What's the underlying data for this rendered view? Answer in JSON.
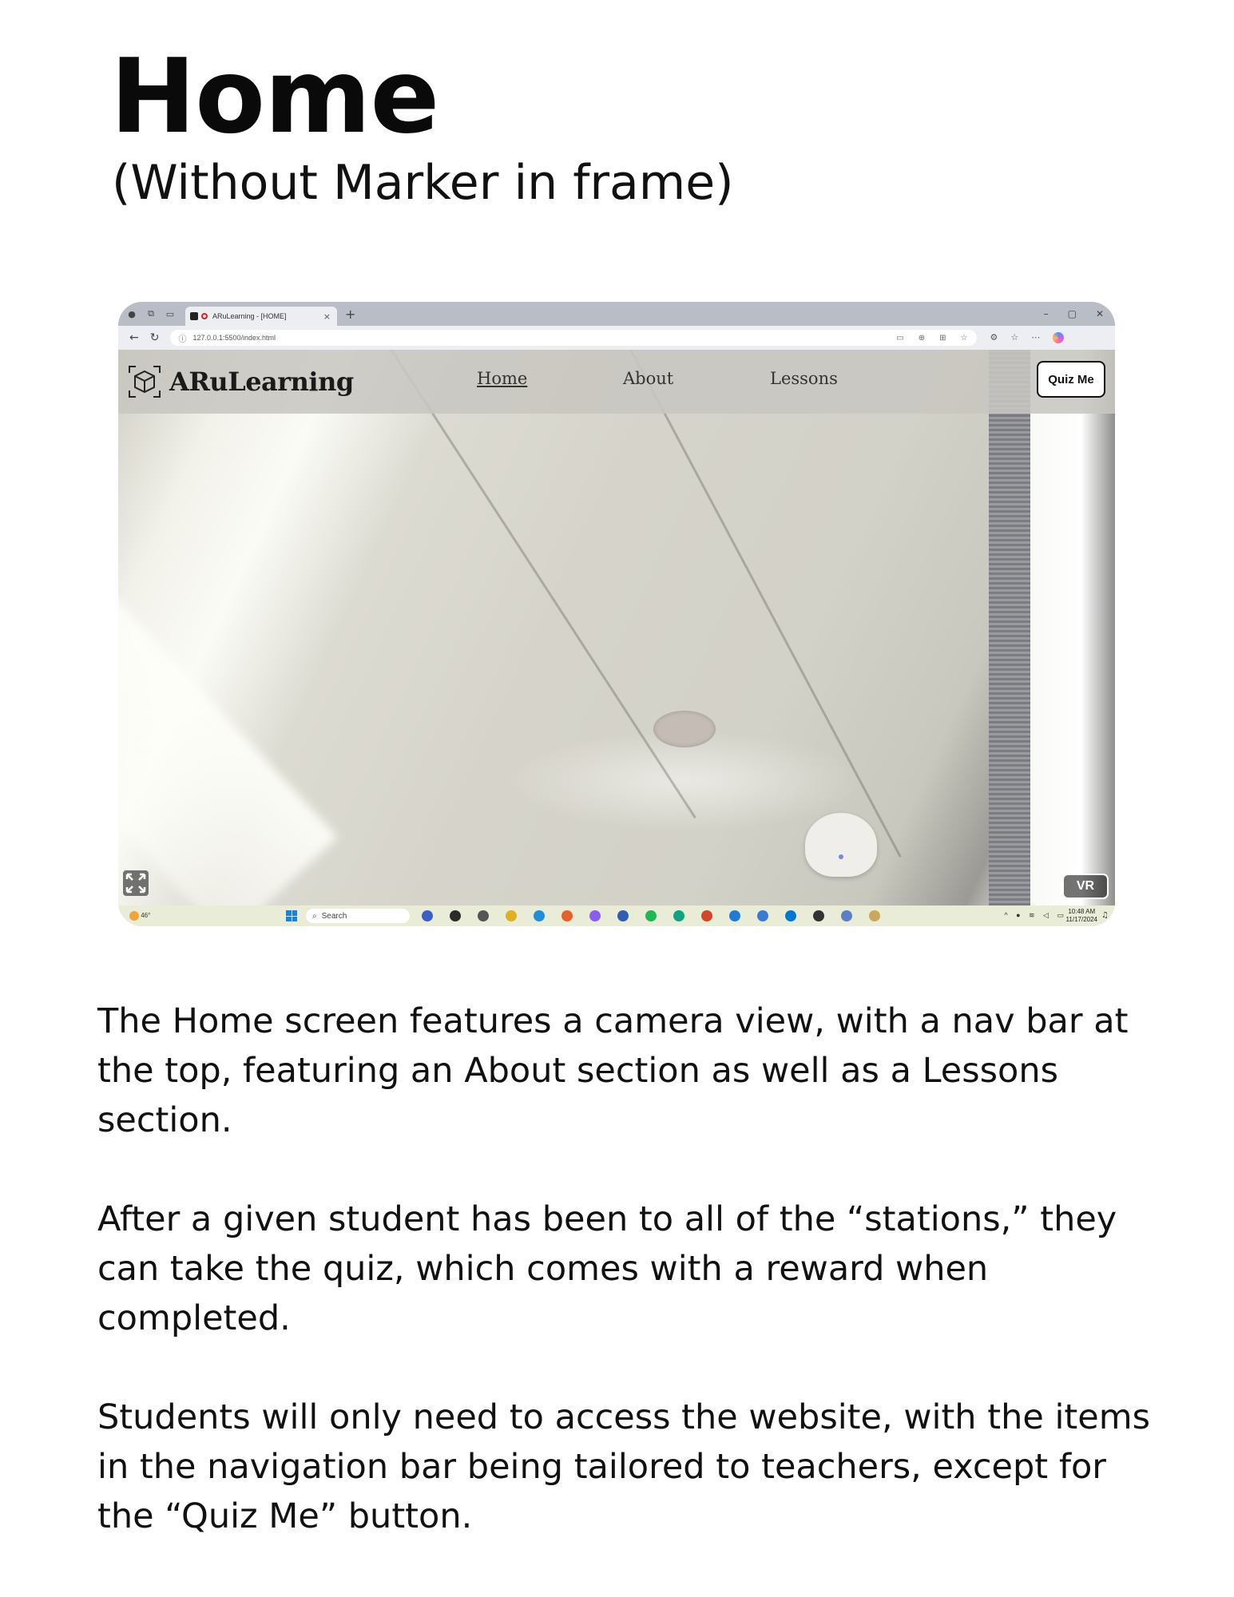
{
  "heading": {
    "title": "Home",
    "subtitle": "(Without Marker in frame)"
  },
  "browser": {
    "tab_title": "ARuLearning - [HOME]",
    "tab_close": "×",
    "new_tab": "+",
    "url": "127.0.0.1:5500/index.html",
    "window_controls": [
      "–",
      "▢",
      "✕"
    ]
  },
  "website": {
    "logo_text": "ARuLearning",
    "nav": [
      {
        "label": "Home",
        "active": true
      },
      {
        "label": "About",
        "active": false
      },
      {
        "label": "Lessons",
        "active": false
      }
    ],
    "quiz_button": "Quiz Me",
    "vr_button": "VR"
  },
  "taskbar": {
    "weather": "46°",
    "search_placeholder": "Search",
    "time": "10:48 AM",
    "date": "11/17/2024",
    "app_colors": [
      "#3b5fc4",
      "#2b2b2b",
      "#555555",
      "#e0b020",
      "#1e8fd8",
      "#e6612a",
      "#8a5cf0",
      "#2f5fb0",
      "#1db954",
      "#10a37f",
      "#d24726",
      "#1f7bd6",
      "#3a7bd5",
      "#0078d4",
      "#333333",
      "#5a7fc4",
      "#caa85a"
    ]
  },
  "description": [
    "The Home screen features a camera view, with a nav bar at the top, featuring an About section as well as a Lessons section.",
    "After a given student has been to all of the “stations,” they can take the quiz, which comes with a reward when completed.",
    "Students will only need to access the website, with the items in the navigation bar being tailored to teachers, except for the “Quiz Me” button."
  ]
}
